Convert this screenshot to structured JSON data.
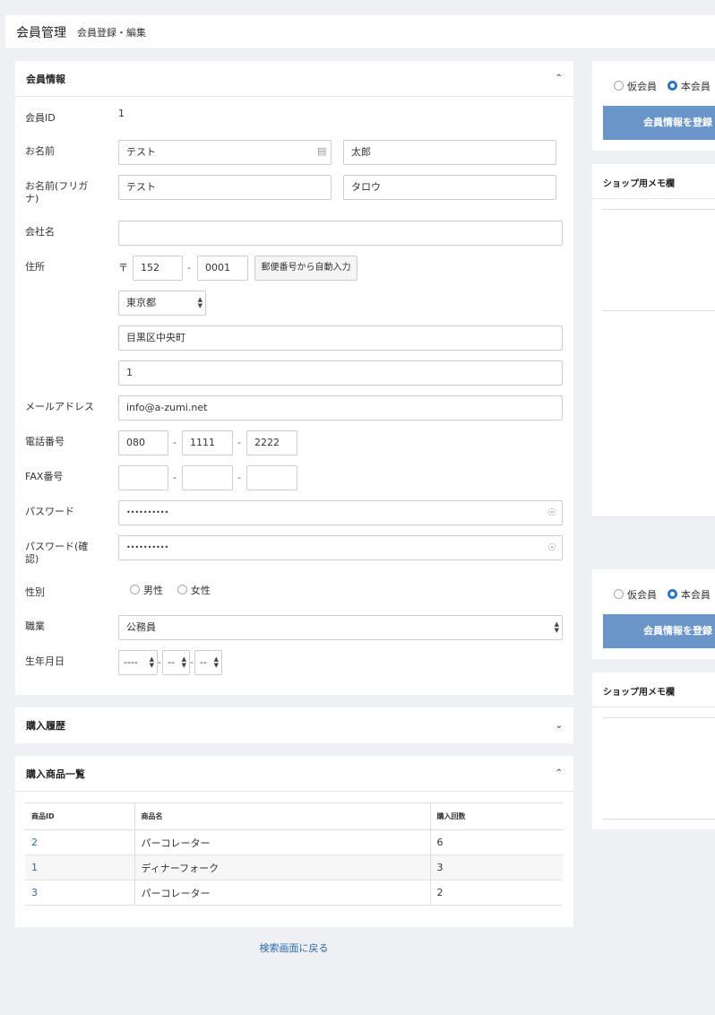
{
  "header": {
    "title": "会員管理",
    "subtitle": "会員登録・編集"
  },
  "member_info": {
    "heading": "会員情報",
    "labels": {
      "id": "会員ID",
      "name": "お名前",
      "kana": "お名前(フリガナ)",
      "company": "会社名",
      "address": "住所",
      "email": "メールアドレス",
      "phone": "電話番号",
      "fax": "FAX番号",
      "password": "パスワード",
      "password_confirm": "パスワード(確認)",
      "gender": "性別",
      "job": "職業",
      "birthday": "生年月日"
    },
    "id_value": "1",
    "last_name": "テスト",
    "first_name": "太郎",
    "last_kana": "テスト",
    "first_kana": "タロウ",
    "company": "",
    "postal_mark": "〒",
    "zip1": "152",
    "zip2": "0001",
    "zip_button": "郵便番号から自動入力",
    "pref": "東京都",
    "addr1": "目黒区中央町",
    "addr2": "1",
    "email": "info@a-zumi.net",
    "phone1": "080",
    "phone2": "1111",
    "phone3": "2222",
    "fax1": "",
    "fax2": "",
    "fax3": "",
    "password": "••••••••••",
    "password_confirm": "••••••••••",
    "gender_male": "男性",
    "gender_female": "女性",
    "job": "公務員",
    "birth_year": "----",
    "birth_month": "--",
    "birth_day": "--",
    "dash": "-"
  },
  "purchase_history": {
    "heading": "購入履歴"
  },
  "purchased_products": {
    "heading": "購入商品一覧",
    "columns": [
      "商品ID",
      "商品名",
      "購入回数"
    ],
    "rows": [
      {
        "id": "2",
        "name": "パーコレーター",
        "count": "6"
      },
      {
        "id": "1",
        "name": "ディナーフォーク",
        "count": "3"
      },
      {
        "id": "3",
        "name": "パーコレーター",
        "count": "2"
      }
    ]
  },
  "back_link": "検索画面に戻る",
  "sidebar": {
    "status_provisional": "仮会員",
    "status_member": "本会員",
    "register_button": "会員情報を登録",
    "memo_title": "ショップ用メモ欄"
  },
  "colors": {
    "accent": "#2f77c6",
    "primary_button": "#6a95c9",
    "background": "#eff0f4",
    "link": "#2b6aa8"
  }
}
